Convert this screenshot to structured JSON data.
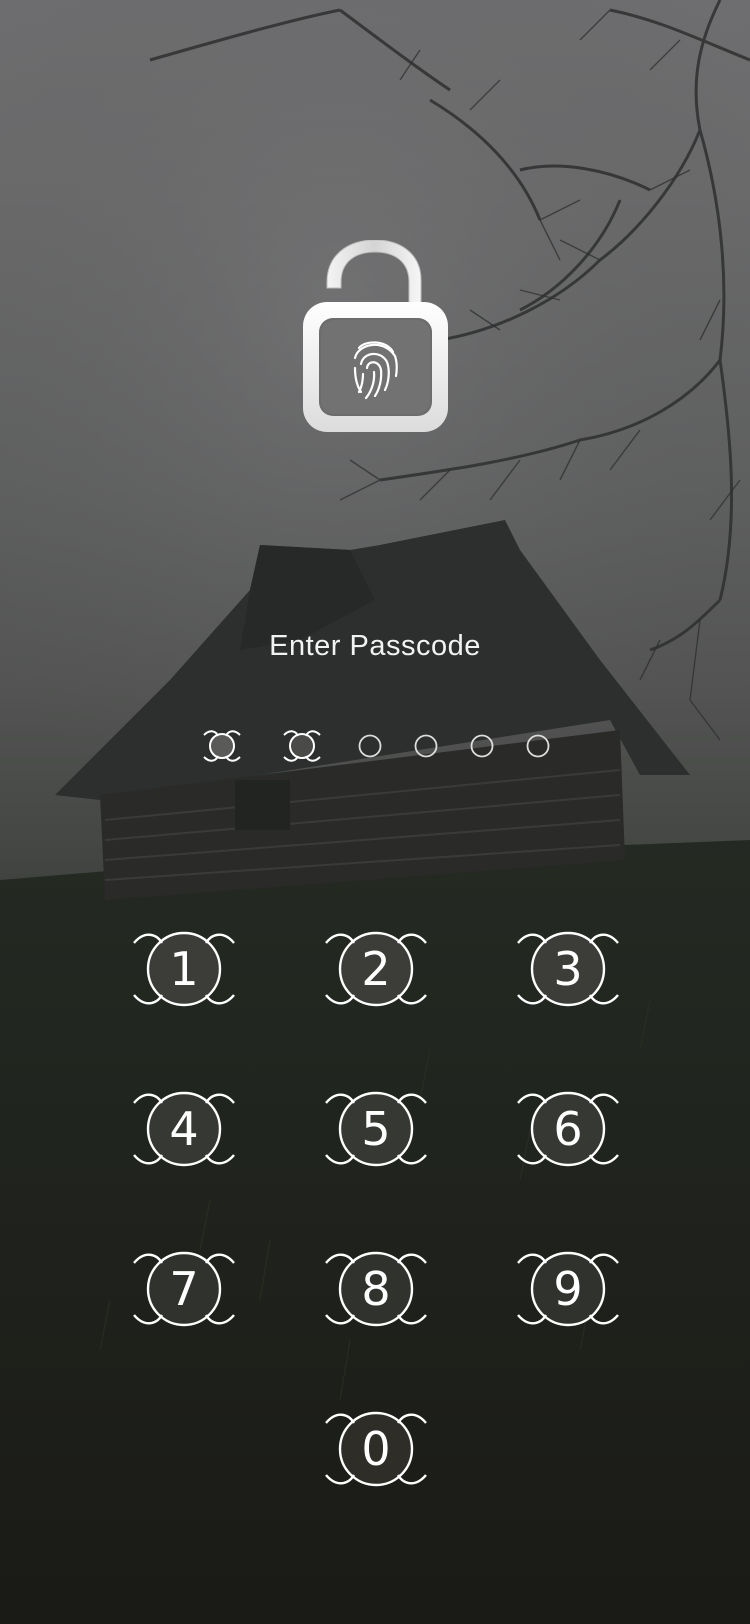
{
  "lock_screen": {
    "title": "Enter Passcode",
    "lock_icon": "fingerprint-padlock-icon",
    "passcode_length": 6,
    "filled_count": 2
  },
  "keypad": {
    "keys": [
      "1",
      "2",
      "3",
      "4",
      "5",
      "6",
      "7",
      "8",
      "9",
      "0"
    ]
  },
  "colors": {
    "text": "#ffffff",
    "key_fill": "#3a3b38",
    "outline": "#ffffff"
  }
}
